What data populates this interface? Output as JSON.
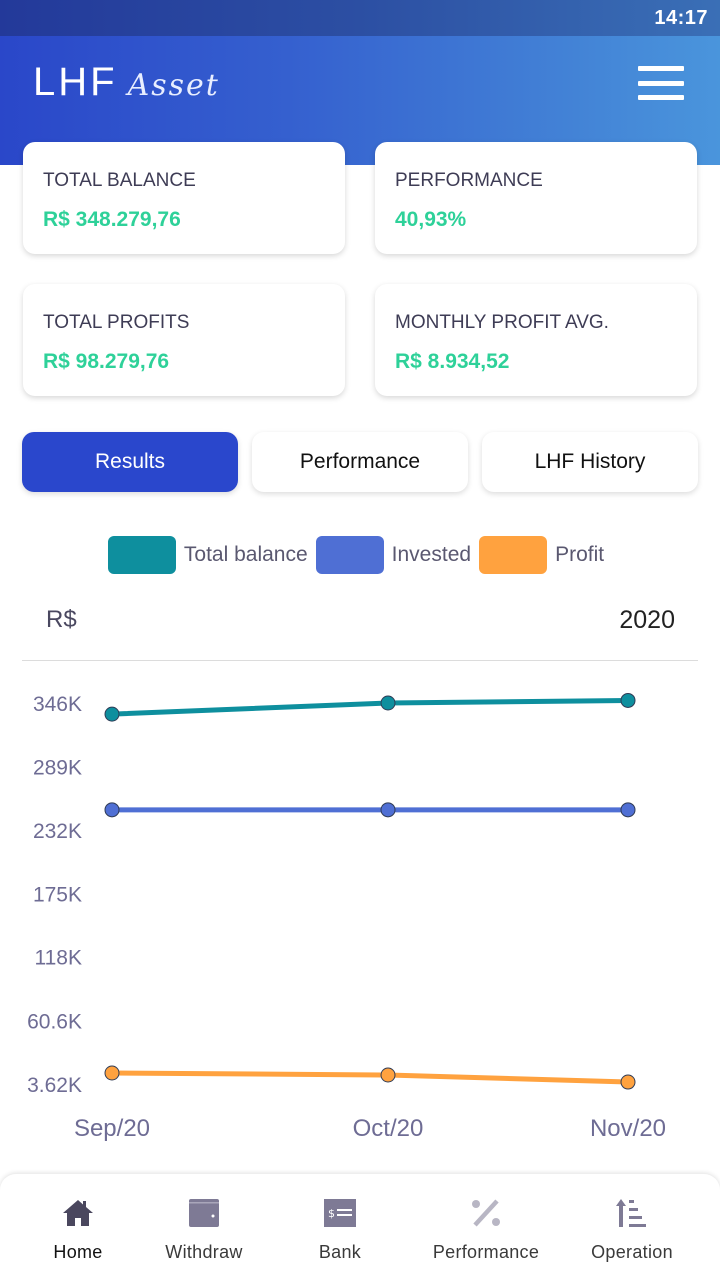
{
  "status_bar": {
    "time": "14:17"
  },
  "header": {
    "logo_main": "LHF",
    "logo_sub": "Asset",
    "menu_icon": "hamburger-menu-icon"
  },
  "cards": {
    "total_balance": {
      "label": "TOTAL BALANCE",
      "value": "R$ 348.279,76"
    },
    "performance": {
      "label": "PERFORMANCE",
      "value": "40,93%"
    },
    "total_profits": {
      "label": "TOTAL PROFITS",
      "value": "R$ 98.279,76"
    },
    "monthly_avg": {
      "label": "MONTHLY PROFIT AVG.",
      "value": "R$ 8.934,52"
    }
  },
  "tabs": [
    {
      "label": "Results",
      "active": true
    },
    {
      "label": "Performance",
      "active": false
    },
    {
      "label": "LHF History",
      "active": false
    }
  ],
  "colors": {
    "accent": "#2a47cc",
    "value_green": "#2ed199",
    "total_balance": "#0e8f9e",
    "invested": "#4f6fd4",
    "profit": "#ffa23f"
  },
  "chart_data": {
    "type": "line",
    "unit_label": "R$",
    "year_label": "2020",
    "categories": [
      "Sep/20",
      "Oct/20",
      "Nov/20"
    ],
    "y_ticks": [
      "346K",
      "289K",
      "232K",
      "175K",
      "118K",
      "60.6K",
      "3.62K"
    ],
    "y_tick_values": [
      346000,
      289000,
      232000,
      175000,
      118000,
      60600,
      3620
    ],
    "ylim": [
      3620,
      346000
    ],
    "grid": false,
    "legend_position": "top-center",
    "series": [
      {
        "name": "Total balance",
        "color": "#0e8f9e",
        "values": [
          336000,
          346000,
          348280
        ]
      },
      {
        "name": "Invested",
        "color": "#4f6fd4",
        "values": [
          250000,
          250000,
          250000
        ]
      },
      {
        "name": "Profit",
        "color": "#ffa23f",
        "values": [
          13500,
          11700,
          5400
        ]
      }
    ]
  },
  "bottom_nav": [
    {
      "label": "Home",
      "icon": "home-icon",
      "active": true
    },
    {
      "label": "Withdraw",
      "icon": "wallet-icon",
      "active": false
    },
    {
      "label": "Bank",
      "icon": "bank-transfer-icon",
      "active": false
    },
    {
      "label": "Performance",
      "icon": "percent-icon",
      "active": false
    },
    {
      "label": "Operation",
      "icon": "sort-operation-icon",
      "active": false
    }
  ]
}
